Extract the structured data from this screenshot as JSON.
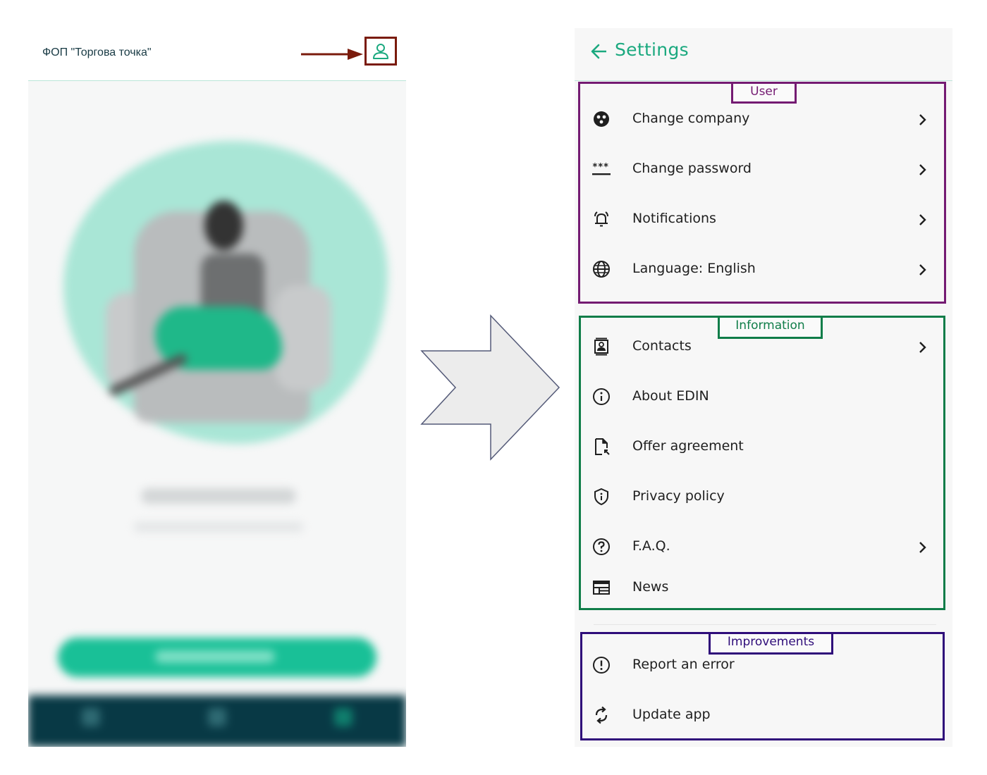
{
  "left_phone": {
    "company_name": "ФОП \"Торгова точка\"",
    "profile_icon": "user-profile-icon",
    "accent_color": "#1ba97f",
    "highlight_color": "#7a1b0c"
  },
  "settings": {
    "title": "Settings",
    "back_icon": "arrow-left-icon",
    "accent_color": "#1ba97f",
    "groups": {
      "user": {
        "tag": "User",
        "color": "#741b72",
        "items": [
          {
            "label": "Change company",
            "icon": "company-icon",
            "has_chevron": true
          },
          {
            "label": "Change password",
            "icon": "password-icon",
            "has_chevron": true
          },
          {
            "label": "Notifications",
            "icon": "bell-icon",
            "has_chevron": true
          },
          {
            "label": "Language: English",
            "icon": "globe-icon",
            "has_chevron": true
          }
        ]
      },
      "information": {
        "tag": "Information",
        "color": "#107d49",
        "items": [
          {
            "label": "Contacts",
            "icon": "contacts-icon",
            "has_chevron": true
          },
          {
            "label": "About EDIN",
            "icon": "info-icon",
            "has_chevron": false
          },
          {
            "label": "Offer agreement",
            "icon": "document-icon",
            "has_chevron": false
          },
          {
            "label": "Privacy policy",
            "icon": "shield-icon",
            "has_chevron": false
          },
          {
            "label": "F.A.Q.",
            "icon": "question-icon",
            "has_chevron": true
          },
          {
            "label": "News",
            "icon": "news-icon",
            "has_chevron": false
          }
        ]
      },
      "improvements": {
        "tag": "Improvements",
        "color": "#2f0d7a",
        "items": [
          {
            "label": "Report an error",
            "icon": "alert-icon",
            "has_chevron": false
          },
          {
            "label": "Update app",
            "icon": "sync-icon",
            "has_chevron": false
          }
        ]
      }
    }
  }
}
